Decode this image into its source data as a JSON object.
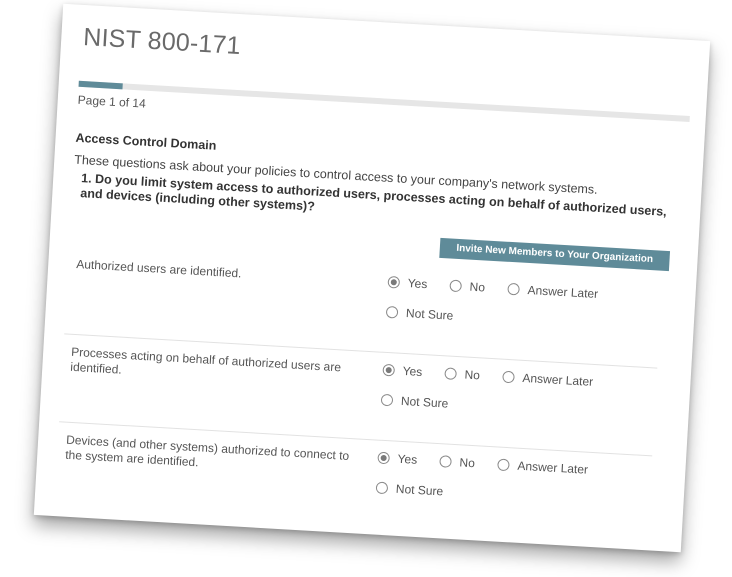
{
  "form": {
    "title": "NIST 800-171",
    "progress_fraction": 0.0714,
    "page_indicator": "Page 1 of 14"
  },
  "section": {
    "heading": "Access Control Domain",
    "description": "These questions ask about your policies to control access to your company's network systems."
  },
  "question": {
    "title": "1. Do you limit system access to authorized users, processes acting on behalf of authorized users, and devices (including other systems)?",
    "invite_button": "Invite New Members to Your Organization"
  },
  "options": {
    "yes": "Yes",
    "no": "No",
    "later": "Answer Later",
    "not_sure": "Not Sure"
  },
  "items": [
    {
      "label": "Authorized users are identified.",
      "selected": "Yes"
    },
    {
      "label": "Processes acting on behalf of authorized users are identified.",
      "selected": "Yes"
    },
    {
      "label": "Devices (and other systems) authorized to connect to the system are identified.",
      "selected": "Yes"
    }
  ],
  "colors": {
    "accent": "#5f8b99",
    "track": "#e6e6e6"
  }
}
